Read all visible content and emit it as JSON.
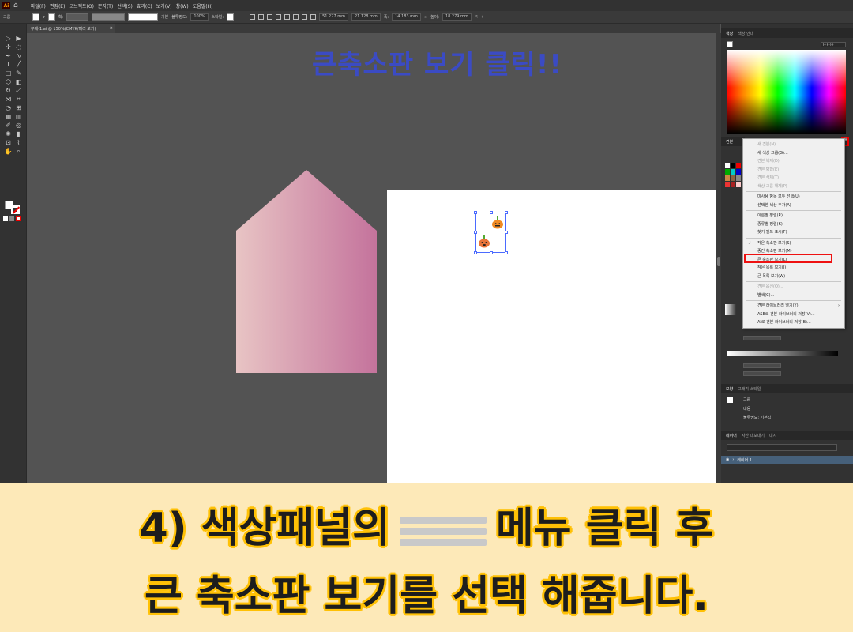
{
  "menubar": {
    "items": [
      "파일(F)",
      "편집(E)",
      "오브젝트(O)",
      "문자(T)",
      "선택(S)",
      "효과(C)",
      "보기(V)",
      "창(W)",
      "도움말(H)"
    ]
  },
  "controlbar": {
    "group_label": "그룹",
    "stroke_label": "획:",
    "stroke_style": "기본",
    "opacity_label": "불투명도:",
    "opacity_value": "100%",
    "style_label": "스타일:",
    "x_value": "51.227 mm",
    "y_value": "21.128 mm",
    "w_label": "폭:",
    "w_value": "14.183 mm",
    "h_label": "높이:",
    "h_value": "18.279 mm"
  },
  "document": {
    "tab_title": "무제-1.ai @ 150%(CMYK/미리 보기)",
    "close": "×"
  },
  "canvas": {
    "instruction": "큰축소판 보기 클릭!!",
    "house_gradient": [
      "#e8c4c4",
      "#c4739c"
    ]
  },
  "panels": {
    "color_tabs": [
      "색상",
      "색상 안내"
    ],
    "hex_value": "FFFFFF",
    "swatch_tab": "견본",
    "appearance_tabs": [
      "모양",
      "그래픽 스타일"
    ],
    "appearance_rows": [
      "그룹",
      "내용",
      "불투명도: 기본값"
    ],
    "layers_tabs": [
      "레이어",
      "자산 내보내기",
      "대지"
    ],
    "layer_name": "레이어 1"
  },
  "context_menu": {
    "items": [
      {
        "label": "새 견본(N)...",
        "disabled": true
      },
      {
        "label": "새 색상 그룹(G)...",
        "disabled": false
      },
      {
        "label": "견본 복제(D)",
        "disabled": true
      },
      {
        "label": "견본 병합(E)",
        "disabled": true
      },
      {
        "label": "견본 삭제(T)",
        "disabled": true
      },
      {
        "label": "색상 그룹 해제(P)",
        "disabled": true
      },
      {
        "sep": true
      },
      {
        "label": "미사용 항목 모두 선택(U)",
        "disabled": false
      },
      {
        "label": "선택한 색상 추가(A)",
        "disabled": false
      },
      {
        "sep": true
      },
      {
        "label": "이름별 정렬(R)",
        "disabled": false
      },
      {
        "label": "종류별 정렬(K)",
        "disabled": false
      },
      {
        "label": "찾기 필드 표시(F)",
        "disabled": false
      },
      {
        "sep": true
      },
      {
        "label": "작은 축소판 보기(S)",
        "disabled": false,
        "checked": true
      },
      {
        "label": "중간 축소판 보기(M)",
        "disabled": false
      },
      {
        "label": "큰 축소판 보기(L)",
        "disabled": false
      },
      {
        "label": "작은 목록 보기(I)",
        "disabled": false
      },
      {
        "label": "큰 목록 보기(W)",
        "disabled": false
      },
      {
        "sep": true
      },
      {
        "label": "견본 옵션(O)...",
        "disabled": true
      },
      {
        "label": "별색(C)...",
        "disabled": false
      },
      {
        "sep": true
      },
      {
        "label": "견본 라이브러리 열기(Y)",
        "disabled": false,
        "submenu": true
      },
      {
        "label": "ASE로 견본 라이브러리 저장(V)...",
        "disabled": false
      },
      {
        "label": "AI로 견본 라이브러리 저장(B)...",
        "disabled": false
      }
    ],
    "highlight_color": "#ee1111"
  },
  "banner": {
    "line1_before": "4) 색상패널의",
    "line1_after": "메뉴 클릭 후",
    "line2": "큰 축소판 보기를 선택 해줍니다.",
    "bg_color": "#fde9b8",
    "outline_color": "#ffc107"
  }
}
